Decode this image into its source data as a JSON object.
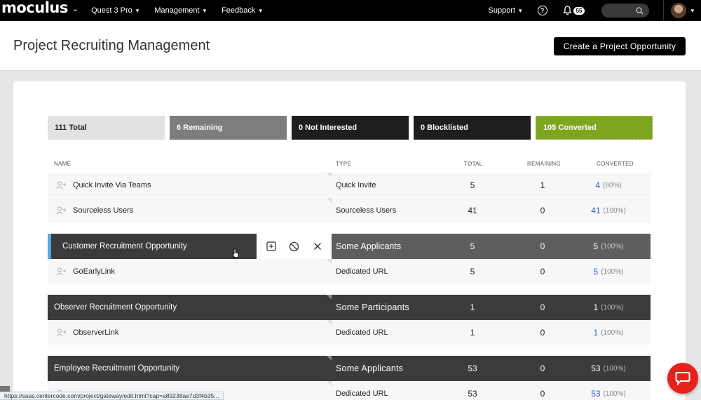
{
  "nav": {
    "logo": "moculus",
    "menu": [
      {
        "label": "Quest 3 Pro"
      },
      {
        "label": "Management"
      },
      {
        "label": "Feedback"
      }
    ],
    "support": "Support",
    "notification_count": "55"
  },
  "header": {
    "title": "Project Recruiting Management",
    "create_button": "Create a Project Opportunity"
  },
  "stats": {
    "total": "111  Total",
    "remaining": "6  Remaining",
    "not_interested": "0  Not Interested",
    "blocklisted": "0  Blocklisted",
    "converted": "105  Converted"
  },
  "table": {
    "columns": {
      "name": "NAME",
      "type": "TYPE",
      "total": "TOTAL",
      "remaining": "REMAINING",
      "converted": "CONVERTED"
    },
    "rows": [
      {
        "kind": "child",
        "name": "Quick Invite Via Teams",
        "type": "Quick Invite",
        "total": "5",
        "remaining": "1",
        "converted": "4",
        "pct": "(80%)"
      },
      {
        "kind": "child",
        "name": "Sourceless Users",
        "type": "Sourceless Users",
        "total": "41",
        "remaining": "0",
        "converted": "41",
        "pct": "(100%)"
      },
      {
        "kind": "group",
        "name": "Customer Recruitment Opportunity",
        "type": "Some Applicants",
        "total": "5",
        "remaining": "0",
        "converted": "5",
        "pct": "(100%)"
      },
      {
        "kind": "child",
        "name": "GoEarlyLink",
        "type": "Dedicated URL",
        "total": "5",
        "remaining": "0",
        "converted": "5",
        "pct": "(100%)"
      },
      {
        "kind": "group",
        "name": "Observer Recruitment Opportunity",
        "type": "Some Participants",
        "total": "1",
        "remaining": "0",
        "converted": "1",
        "pct": "(100%)"
      },
      {
        "kind": "child",
        "name": "ObserverLink",
        "type": "Dedicated URL",
        "total": "1",
        "remaining": "0",
        "converted": "1",
        "pct": "(100%)"
      },
      {
        "kind": "group",
        "name": "Employee Recruitment Opportunity",
        "type": "Some Applicants",
        "total": "53",
        "remaining": "0",
        "converted": "53",
        "pct": "(100%)"
      },
      {
        "kind": "child",
        "name": "",
        "type": "Dedicated URL",
        "total": "53",
        "remaining": "0",
        "converted": "53",
        "pct": "(100%)"
      }
    ]
  },
  "status_url": "https://saas.centercode.com/project/gateway/edit.html?cap=a89238ae7d3f4b35...",
  "colors": {
    "accent_green": "#7fa51e",
    "link_blue": "#2f62c8",
    "chat_red": "#e8211b"
  }
}
